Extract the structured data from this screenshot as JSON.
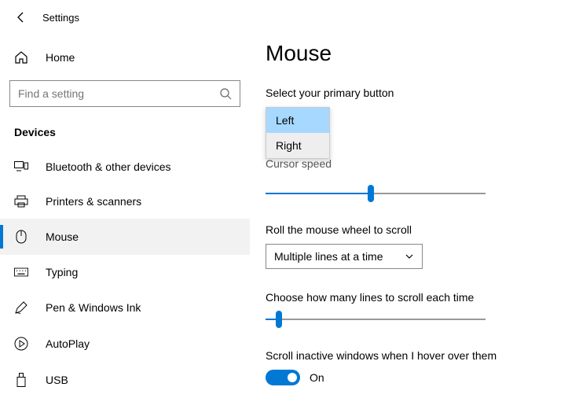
{
  "topbar": {
    "title": "Settings"
  },
  "home": {
    "label": "Home"
  },
  "search": {
    "placeholder": "Find a setting"
  },
  "group_header": "Devices",
  "nav": [
    {
      "label": "Bluetooth & other devices"
    },
    {
      "label": "Printers & scanners"
    },
    {
      "label": "Mouse"
    },
    {
      "label": "Typing"
    },
    {
      "label": "Pen & Windows Ink"
    },
    {
      "label": "AutoPlay"
    },
    {
      "label": "USB"
    }
  ],
  "page": {
    "title": "Mouse",
    "primary_button_label": "Select your primary button",
    "primary_options": {
      "left": "Left",
      "right": "Right"
    },
    "cursor_speed_label": "Cursor speed",
    "cursor_speed_pct": 48,
    "roll_label": "Roll the mouse wheel to scroll",
    "roll_value": "Multiple lines at a time",
    "lines_label": "Choose how many lines to scroll each time",
    "lines_pct": 6,
    "inactive_label": "Scroll inactive windows when I hover over them",
    "inactive_state": "On"
  }
}
